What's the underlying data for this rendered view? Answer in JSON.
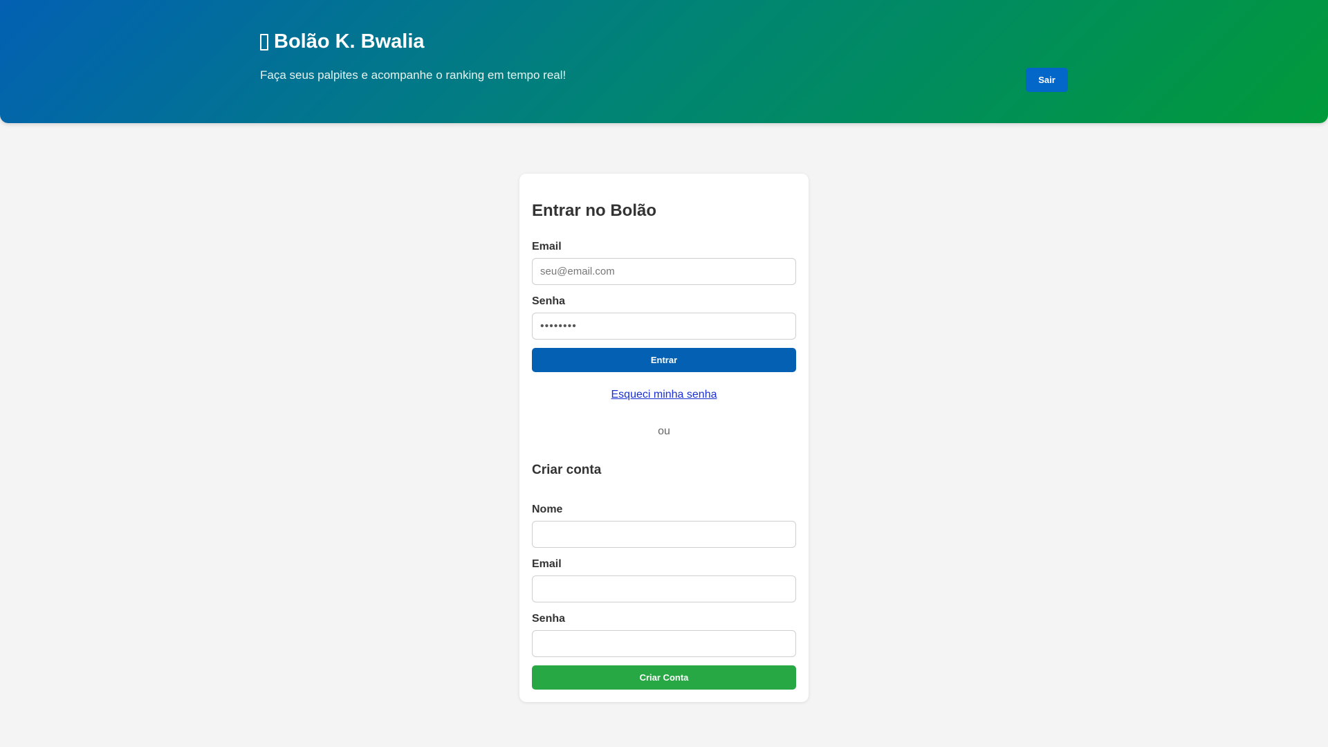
{
  "header": {
    "title": "Bolão K. Bwalia",
    "subtitle": "Faça seus palpites e acompanhe o ranking em tempo real!",
    "logout_label": "Sair",
    "icon": "trophy-icon"
  },
  "login": {
    "title": "Entrar no Bolão",
    "email_label": "Email",
    "email_placeholder": "seu@email.com",
    "email_value": "",
    "password_label": "Senha",
    "password_value": "••••••••",
    "submit_label": "Entrar",
    "forgot_label": "Esqueci minha senha"
  },
  "divider": "ou",
  "register": {
    "title": "Criar conta",
    "name_label": "Nome",
    "name_value": "",
    "email_label": "Email",
    "email_value": "",
    "password_label": "Senha",
    "password_value": "",
    "submit_label": "Criar Conta"
  },
  "colors": {
    "primary": "#0360b3",
    "success": "#28a745",
    "link": "#1a2fd0",
    "header_gradient_start": "#0360b3",
    "header_gradient_end": "#019a3a",
    "background": "#f4f4f4"
  }
}
